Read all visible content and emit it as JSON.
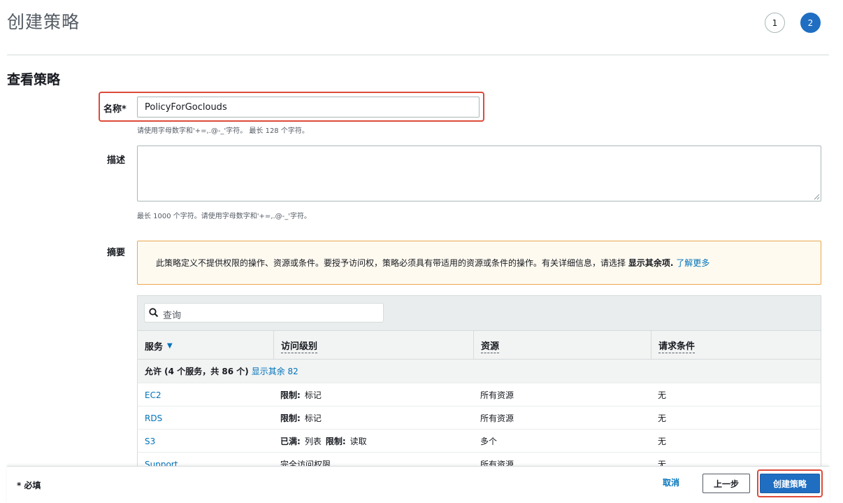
{
  "header": {
    "title": "创建策略",
    "steps": [
      "1",
      "2"
    ],
    "active_step": 2
  },
  "section": {
    "title": "查看策略"
  },
  "name_field": {
    "label": "名称*",
    "value": "PolicyForGoclouds",
    "hint": "请使用字母数字和'+=,.@-_'字符。 最长 128 个字符。"
  },
  "description_field": {
    "label": "描述",
    "value": "",
    "hint": "最长 1000 个字符。请使用字母数字和'+=,.@-_'字符。"
  },
  "summary": {
    "label": "摘要",
    "warning": {
      "text": "此策略定义不提供权限的操作、资源或条件。要授予访问权，策略必须具有带适用的资源或条件的操作。有关详细信息，请选择",
      "bold_text": "显示其余项.",
      "link_text": "了解更多"
    },
    "search_placeholder": "查询",
    "columns": [
      "服务",
      "访问级别",
      "资源",
      "请求条件"
    ],
    "group": {
      "label": "允许 (4 个服务，共 86 个)",
      "link_text": "显示其余 82"
    },
    "rows": [
      {
        "service": "EC2",
        "access": [
          {
            "bold": "限制:",
            "text": "标记"
          }
        ],
        "resource": "所有资源",
        "condition": "无"
      },
      {
        "service": "RDS",
        "access": [
          {
            "bold": "限制:",
            "text": "标记"
          }
        ],
        "resource": "所有资源",
        "condition": "无"
      },
      {
        "service": "S3",
        "access": [
          {
            "bold": "已满:",
            "text": "列表"
          },
          {
            "bold": "限制:",
            "text": "读取"
          }
        ],
        "resource": "多个",
        "condition": "无"
      },
      {
        "service": "Support",
        "access": [
          {
            "bold": "",
            "text": "完全访问权限"
          }
        ],
        "resource": "所有资源",
        "condition": "无"
      }
    ]
  },
  "footer": {
    "required_note": "* 必填",
    "cancel_label": "取消",
    "prev_label": "上一步",
    "create_label": "创建策略"
  },
  "colors": {
    "accent": "#1f6ec2",
    "link": "#0073bb",
    "highlight": "#dd4b39",
    "warning_border": "#e9a64d"
  }
}
